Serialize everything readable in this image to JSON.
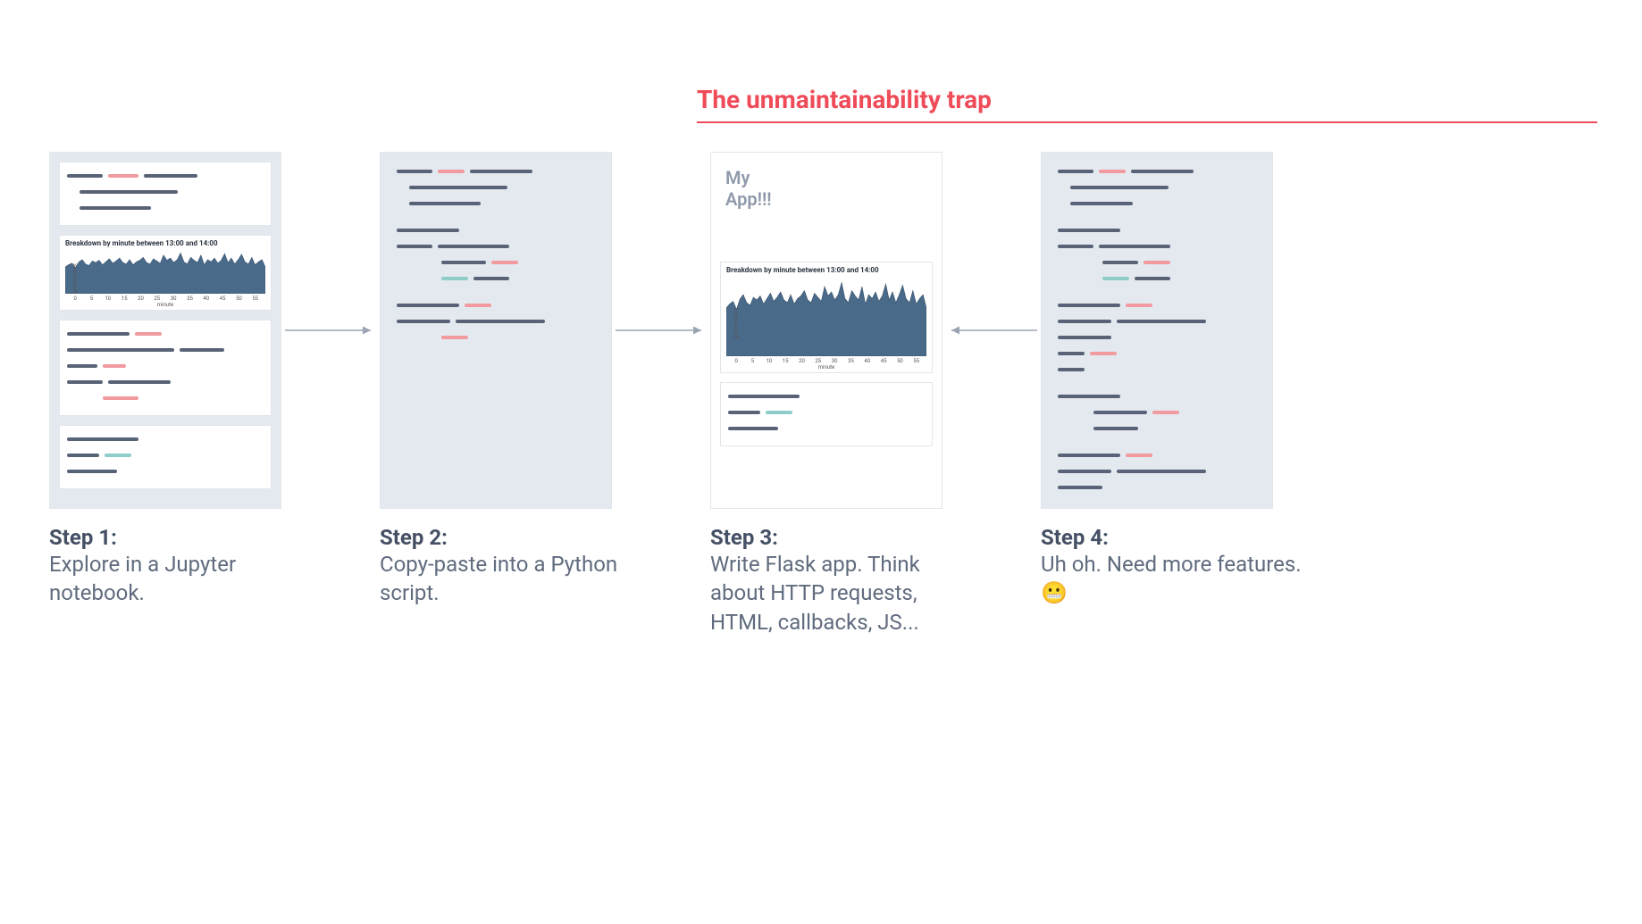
{
  "trap_title": "The unmaintainability trap",
  "steps": [
    {
      "label": "Step 1:",
      "text": "Explore in a Jupyter notebook."
    },
    {
      "label": "Step 2:",
      "text": "Copy-paste into a Python script."
    },
    {
      "label": "Step 3:",
      "text": "Write Flask app. Think about HTTP requests, HTML, callbacks, JS..."
    },
    {
      "label": "Step 4:",
      "text": "Uh oh. Need more features.😬"
    }
  ],
  "app_heading": "My\nApp!!!",
  "chart_data": {
    "type": "area",
    "title": "Breakdown by minute between 13:00 and 14:00",
    "xlabel": "minute",
    "ylabel": "go live count",
    "ylim": [
      0,
      120
    ],
    "x": [
      0,
      1,
      2,
      3,
      4,
      5,
      6,
      7,
      8,
      9,
      10,
      11,
      12,
      13,
      14,
      15,
      16,
      17,
      18,
      19,
      20,
      21,
      22,
      23,
      24,
      25,
      26,
      27,
      28,
      29,
      30,
      31,
      32,
      33,
      34,
      35,
      36,
      37,
      38,
      39,
      40,
      41,
      42,
      43,
      44,
      45,
      46,
      47,
      48,
      49,
      50,
      51,
      52,
      53,
      54,
      55,
      56,
      57,
      58,
      59
    ],
    "values": [
      72,
      78,
      82,
      70,
      85,
      92,
      80,
      76,
      88,
      84,
      90,
      78,
      86,
      94,
      82,
      88,
      96,
      84,
      80,
      92,
      78,
      86,
      90,
      98,
      84,
      80,
      94,
      88,
      82,
      104,
      90,
      96,
      84,
      92,
      110,
      86,
      80,
      98,
      90,
      84,
      104,
      78,
      92,
      86,
      96,
      82,
      90,
      108,
      84,
      96,
      80,
      92,
      106,
      86,
      80,
      98,
      78,
      86,
      92,
      72
    ],
    "xticks": [
      0,
      5,
      10,
      15,
      20,
      25,
      30,
      35,
      40,
      45,
      50,
      55
    ]
  }
}
